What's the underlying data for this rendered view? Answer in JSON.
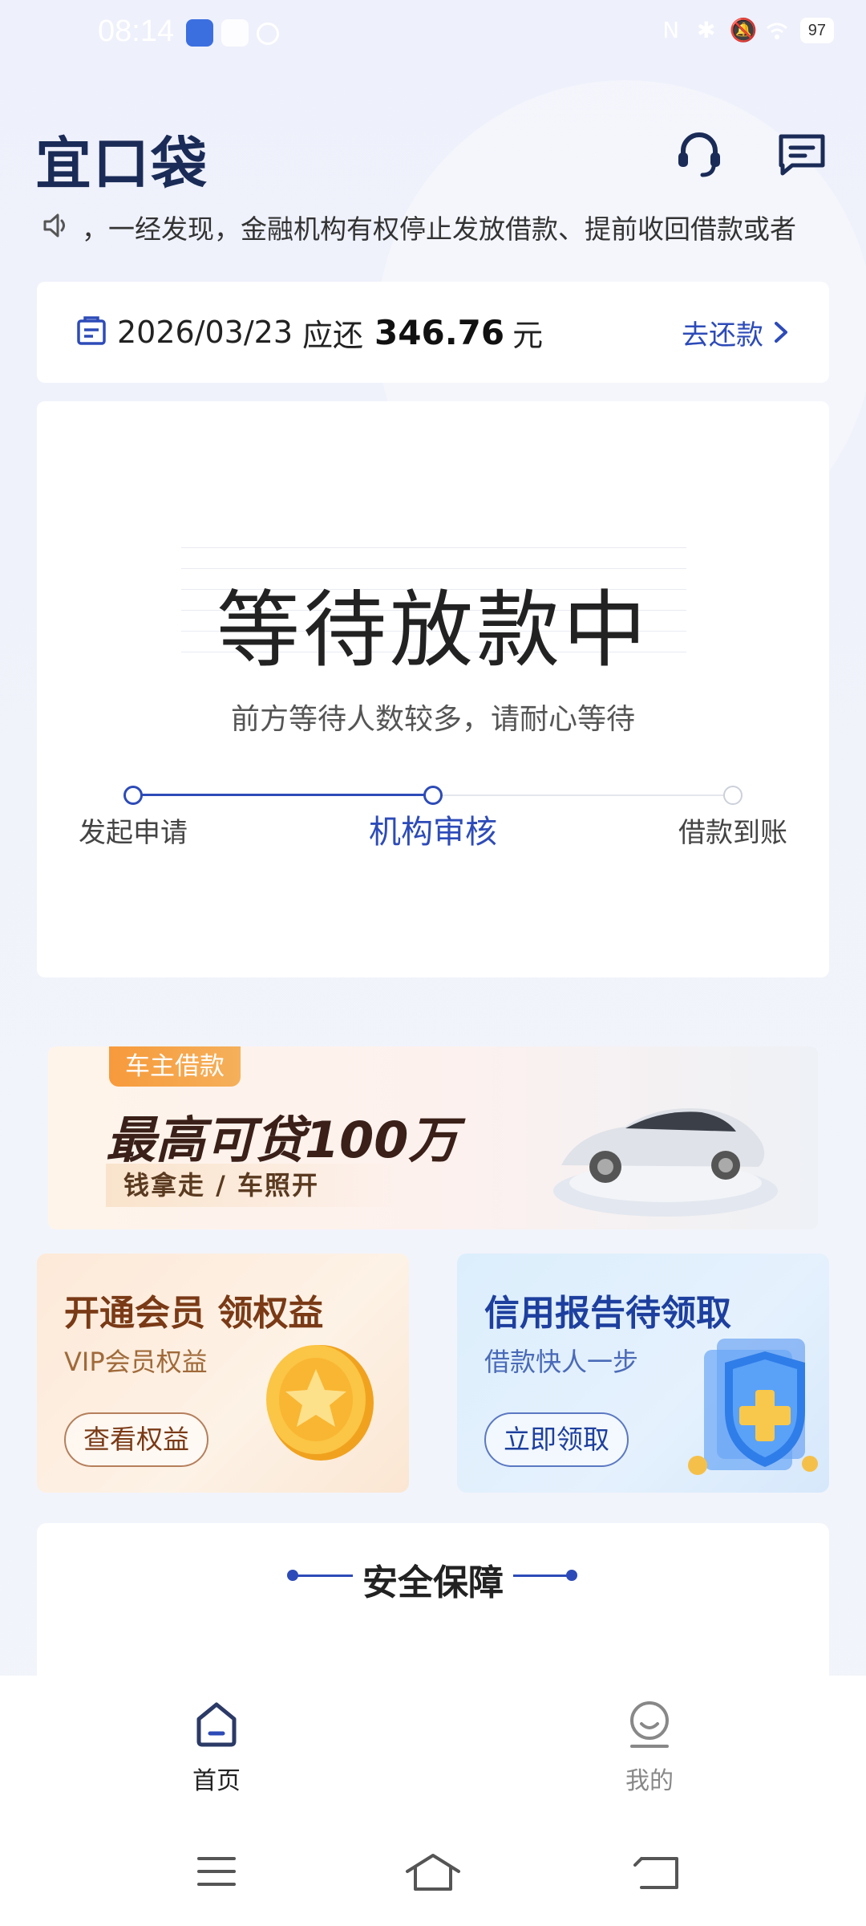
{
  "status_bar": {
    "time": "08:14",
    "battery": "97"
  },
  "header": {
    "logo": "宜口袋"
  },
  "notice": {
    "text": "，一经发现，金融机构有权停止发放借款、提前收回借款或者"
  },
  "repay": {
    "date": "2026/03/23",
    "label": "应还",
    "amount": "346.76",
    "unit": "元",
    "action": "去还款"
  },
  "loan_status": {
    "title": "等待放款中",
    "subtitle": "前方等待人数较多，请耐心等待",
    "progress_current_step": 2,
    "steps": [
      {
        "label": "发起申请"
      },
      {
        "label": "机构审核"
      },
      {
        "label": "借款到账"
      }
    ]
  },
  "promo": {
    "tag": "车主借款",
    "title": "最高可贷100万",
    "subtitle": "钱拿走 / 车照开"
  },
  "cards": {
    "vip": {
      "title": "开通会员 领权益",
      "subtitle": "VIP会员权益",
      "button": "查看权益"
    },
    "credit": {
      "title": "信用报告待领取",
      "subtitle": "借款快人一步",
      "button": "立即领取"
    }
  },
  "security": {
    "title": "安全保障"
  },
  "tabs": {
    "home": "首页",
    "mine": "我的"
  },
  "colors": {
    "accent": "#2d4bb8",
    "logo": "#1a2b57"
  }
}
